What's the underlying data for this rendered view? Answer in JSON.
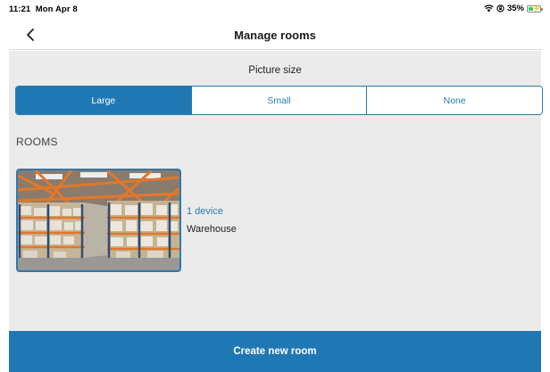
{
  "status_bar": {
    "time": "11:21",
    "date": "Mon Apr 8",
    "battery_percent": "35%",
    "icons": [
      "wifi-icon",
      "orientation-lock-icon",
      "battery-charging-icon"
    ]
  },
  "nav": {
    "title": "Manage rooms",
    "back_icon": "chevron-left-icon"
  },
  "picture_size": {
    "label": "Picture size",
    "options": [
      "Large",
      "Small",
      "None"
    ],
    "selected": "Large"
  },
  "rooms": {
    "heading": "ROOMS",
    "items": [
      {
        "count": "1 device",
        "name": "Warehouse",
        "image": "warehouse-photo"
      }
    ]
  },
  "footer": {
    "create_label": "Create new room"
  },
  "colors": {
    "accent": "#1f78b4",
    "background": "#ebebeb"
  }
}
